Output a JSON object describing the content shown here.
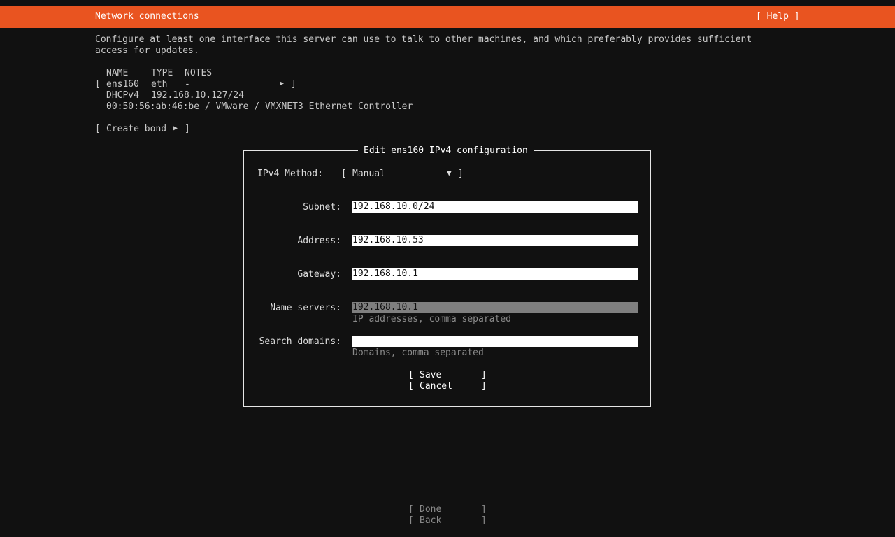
{
  "header": {
    "title": "Network connections",
    "help_label": "[ Help ]"
  },
  "intro": {
    "line1": "Configure at least one interface this server can use to talk to other machines, and which preferably provides sufficient",
    "line2": "access for updates."
  },
  "table": {
    "columns": [
      "NAME",
      "TYPE",
      "NOTES"
    ],
    "interface": {
      "name": "ens160",
      "type": "eth",
      "notes": "-",
      "dhcp_label": "DHCPv4",
      "dhcp_address": "192.168.10.127/24",
      "hw_info": "00:50:56:ab:46:be / VMware / VMXNET3 Ethernet Controller"
    }
  },
  "create_bond_label": "Create bond",
  "dialog": {
    "title": "Edit ens160 IPv4 configuration",
    "method_label": "IPv4 Method:",
    "method_value": "Manual",
    "subnet_label": "Subnet:",
    "subnet_value": "192.168.10.0/24",
    "address_label": "Address:",
    "address_value": "192.168.10.53",
    "gateway_label": "Gateway:",
    "gateway_value": "192.168.10.1",
    "nameservers_label": "Name servers:",
    "nameservers_value": "192.168.10.1",
    "nameservers_hint": "IP addresses, comma separated",
    "searchdomains_label": "Search domains:",
    "searchdomains_value": "",
    "searchdomains_hint": "Domains, comma separated",
    "save_label": "Save",
    "cancel_label": "Cancel"
  },
  "footer": {
    "done_label": "Done",
    "back_label": "Back"
  },
  "colors": {
    "accent": "#e95420",
    "background": "#111111",
    "field_bg": "#ffffff",
    "focused_field_bg": "#7f7f7f"
  },
  "icons": {
    "expand": "triangle-right-icon",
    "dropdown": "triangle-down-icon"
  }
}
